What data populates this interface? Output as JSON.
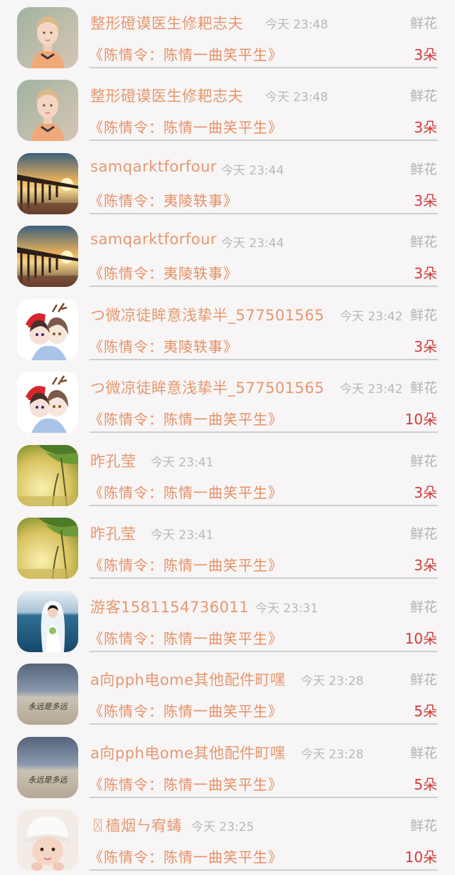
{
  "items": [
    {
      "user": "整形磴谟医生修耙志夫",
      "time": "今天 23:48",
      "gift_type": "鲜花",
      "work": "《陈情令：陈情一曲笑平生》",
      "count": "3朵",
      "avatar": "blonde-girl"
    },
    {
      "user": "整形磴谟医生修耙志夫",
      "time": "今天 23:48",
      "gift_type": "鲜花",
      "work": "《陈情令：陈情一曲笑平生》",
      "count": "3朵",
      "avatar": "blonde-girl"
    },
    {
      "user": "samqarktforfour",
      "time": "今天 23:44",
      "gift_type": "鲜花",
      "work": "《陈情令：夷陵轶事》",
      "count": "3朵",
      "avatar": "sunset-pier"
    },
    {
      "user": "samqarktforfour",
      "time": "今天 23:44",
      "gift_type": "鲜花",
      "work": "《陈情令：夷陵轶事》",
      "count": "3朵",
      "avatar": "sunset-pier"
    },
    {
      "user": "つ微凉徒眸意浅挚半_577501565",
      "time": "今天 23:42",
      "gift_type": "鲜花",
      "work": "《陈情令：夷陵轶事》",
      "count": "3朵",
      "avatar": "anime-couple"
    },
    {
      "user": "つ微凉徒眸意浅挚半_577501565",
      "time": "今天 23:42",
      "gift_type": "鲜花",
      "work": "《陈情令：陈情一曲笑平生》",
      "count": "10朵",
      "avatar": "anime-couple"
    },
    {
      "user": "昨孔莹",
      "time": "今天 23:41",
      "gift_type": "鲜花",
      "work": "《陈情令：陈情一曲笑平生》",
      "count": "3朵",
      "avatar": "green-tree"
    },
    {
      "user": "昨孔莹",
      "time": "今天 23:41",
      "gift_type": "鲜花",
      "work": "《陈情令：陈情一曲笑平生》",
      "count": "3朵",
      "avatar": "green-tree"
    },
    {
      "user": "游客1581154736011",
      "time": "今天 23:31",
      "gift_type": "鲜花",
      "work": "《陈情令：陈情一曲笑平生》",
      "count": "10朵",
      "avatar": "bride-sea"
    },
    {
      "user": "a向pph电ome其他配件町嘿",
      "time": "今天 23:28",
      "gift_type": "鲜花",
      "work": "《陈情令：陈情一曲笑平生》",
      "count": "5朵",
      "avatar": "beach-writing"
    },
    {
      "user": "a向pph电ome其他配件町嘿",
      "time": "今天 23:28",
      "gift_type": "鲜花",
      "work": "《陈情令：陈情一曲笑平生》",
      "count": "5朵",
      "avatar": "beach-writing"
    },
    {
      "user": "〿樯烟ㄣ宥蝳",
      "time": "今天 23:25",
      "gift_type": "鲜花",
      "work": "《陈情令：陈情一曲笑平生》",
      "count": "10朵",
      "avatar": "baby-hat"
    }
  ],
  "avatar_text": {
    "beach-writing": "永远是多远"
  }
}
